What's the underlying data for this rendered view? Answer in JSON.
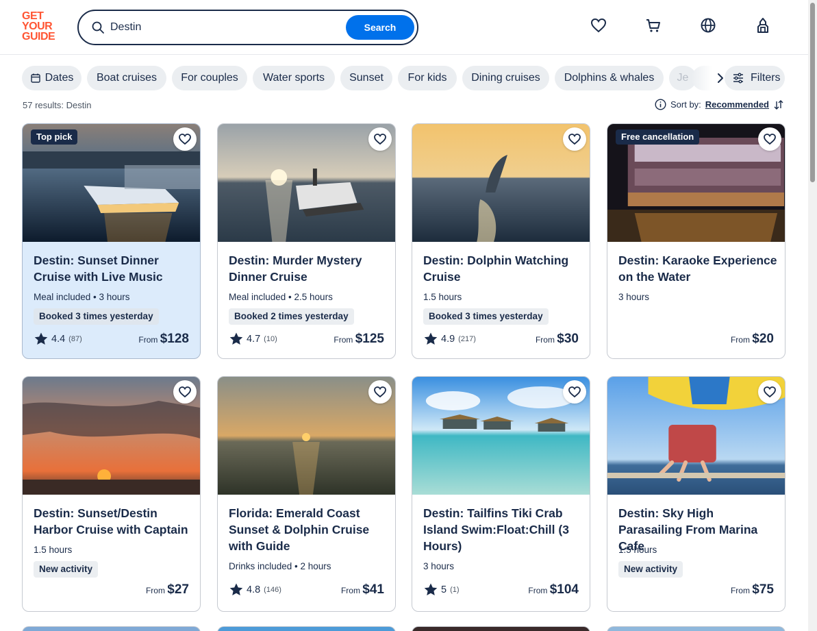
{
  "logo": [
    "GET",
    "YOUR",
    "GUIDE"
  ],
  "search": {
    "value": "Destin",
    "button": "Search"
  },
  "chips": [
    "Dates",
    "Boat cruises",
    "For couples",
    "Water sports",
    "Sunset",
    "For kids",
    "Dining cruises",
    "Dolphins & whales",
    "Je"
  ],
  "filters_label": "Filters",
  "results_text": "57 results: Destin",
  "sort": {
    "label": "Sort by:",
    "value": "Recommended"
  },
  "cards": [
    {
      "title": "Destin: Sunset Dinner Cruise with Live Music",
      "meta": "Meal included • 3 hours",
      "tag": "Booked 3 times yesterday",
      "rating": "4.4",
      "count": "(87)",
      "from": "From",
      "price": "$128",
      "badge": "Top pick"
    },
    {
      "title": "Destin: Murder Mystery Dinner Cruise",
      "meta": "Meal included • 2.5 hours",
      "tag": "Booked 2 times yesterday",
      "rating": "4.7",
      "count": "(10)",
      "from": "From",
      "price": "$125"
    },
    {
      "title": "Destin: Dolphin Watching Cruise",
      "meta": "1.5 hours",
      "tag": "Booked 3 times yesterday",
      "rating": "4.9",
      "count": "(217)",
      "from": "From",
      "price": "$30"
    },
    {
      "title": "Destin: Karaoke Experience on the Water",
      "meta": "3 hours",
      "from": "From",
      "price": "$20",
      "badge": "Free cancellation"
    },
    {
      "title": "Destin: Sunset/Destin Harbor Cruise with Captain",
      "meta": "1.5 hours",
      "tag": "New activity",
      "from": "From",
      "price": "$27"
    },
    {
      "title": "Florida: Emerald Coast Sunset & Dolphin Cruise with Guide",
      "meta": "Drinks included • 2 hours",
      "rating": "4.8",
      "count": "(146)",
      "from": "From",
      "price": "$41"
    },
    {
      "title": "Destin: Tailfins Tiki Crab Island Swim:Float:Chill (3 Hours)",
      "meta": "3 hours",
      "rating": "5",
      "count": "(1)",
      "from": "From",
      "price": "$104"
    },
    {
      "title": "Destin: Sky High Parasailing From Marina Cafe",
      "meta": "1.5 hours",
      "tag": "New activity",
      "from": "From",
      "price": "$75"
    }
  ],
  "colors": {
    "brand": "#ff5533",
    "primary": "#0071eb",
    "text": "#1a2b49",
    "chip": "#ebeef1",
    "highlight": "#dcebfb"
  }
}
